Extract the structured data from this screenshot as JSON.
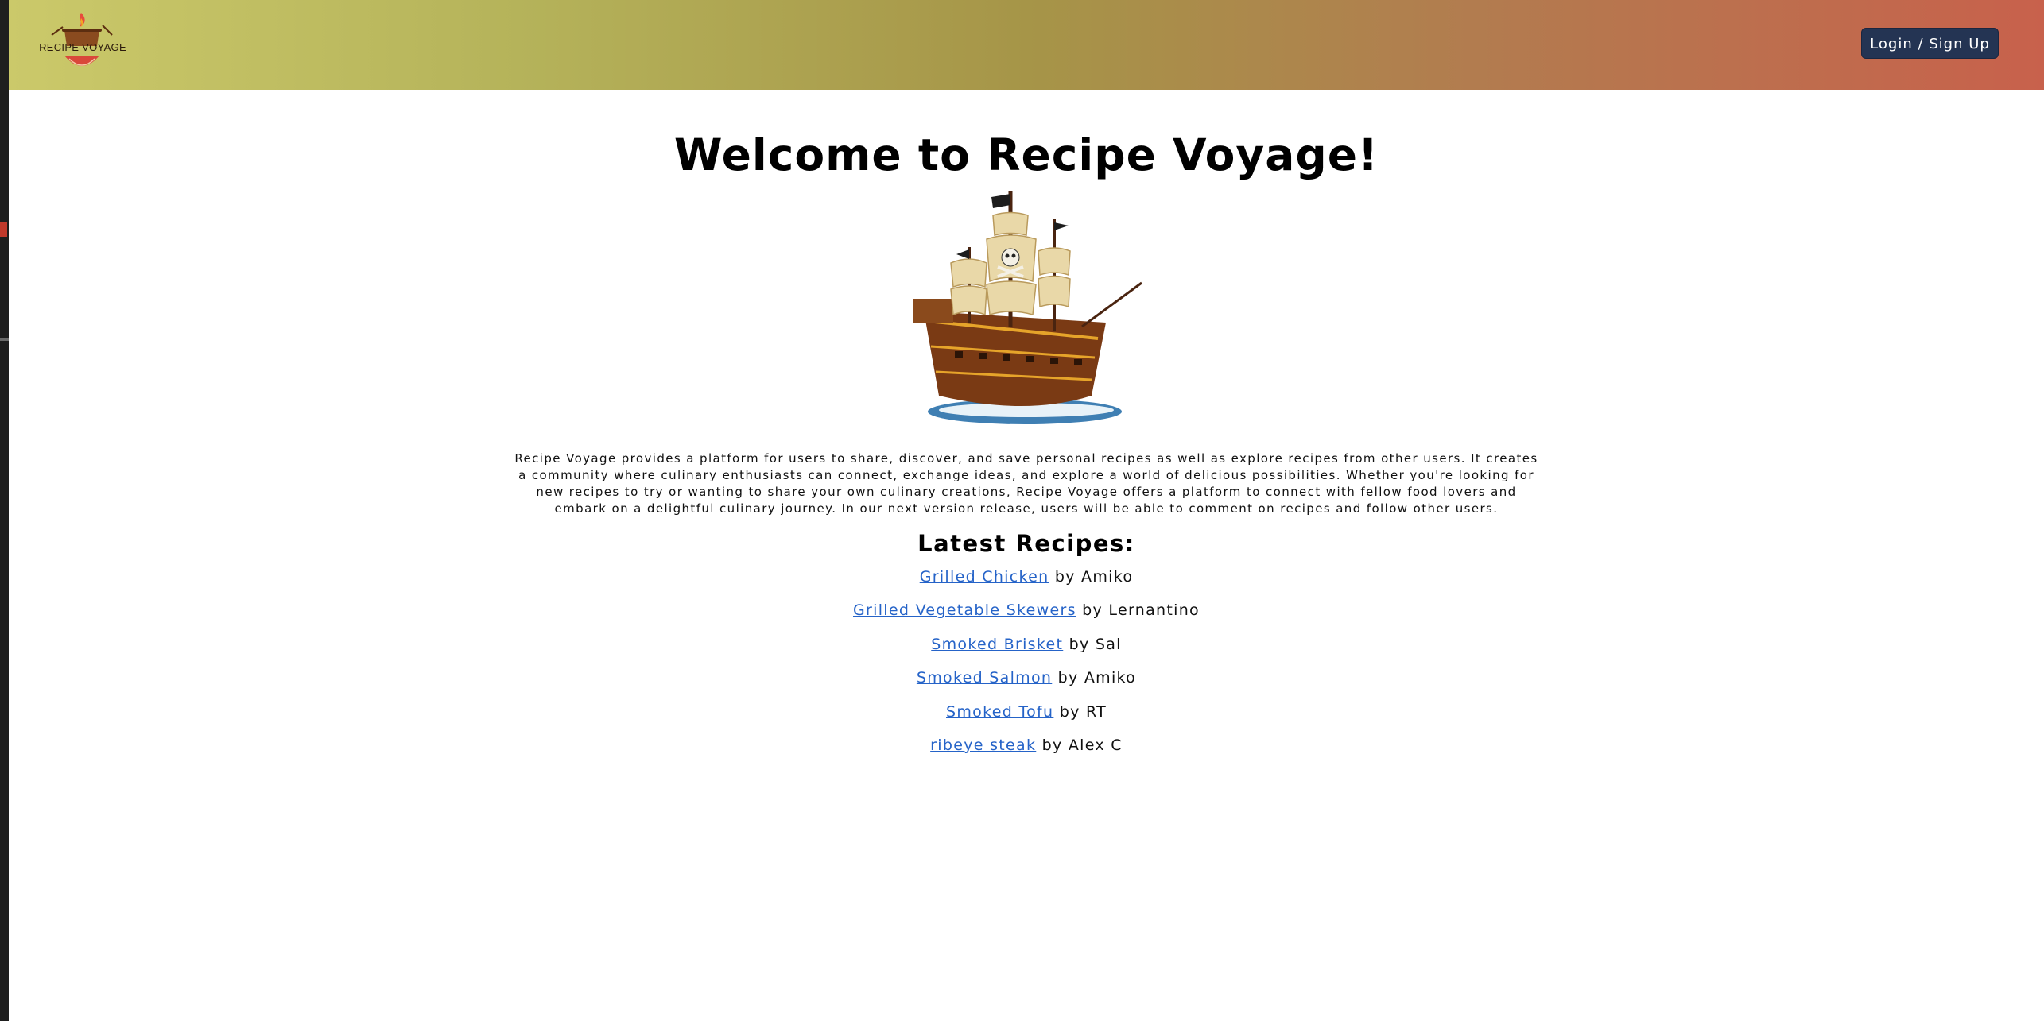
{
  "header": {
    "logo_text": "RECIPE VOYAGE",
    "login_label": "Login / Sign Up"
  },
  "main": {
    "title": "Welcome to Recipe Voyage!",
    "description": "Recipe Voyage provides a platform for users to share, discover, and save personal recipes as well as explore recipes from other users. It creates a community where culinary enthusiasts can connect, exchange ideas, and explore a world of delicious possibilities. Whether you're looking for new recipes to try or wanting to share your own culinary creations, Recipe Voyage offers a platform to connect with fellow food lovers and embark on a delightful culinary journey. In our next version release, users will be able to comment on recipes and follow other users.",
    "latest_heading": "Latest Recipes:",
    "recipes": [
      {
        "name": "Grilled Chicken",
        "author": "by Amiko"
      },
      {
        "name": "Grilled Vegetable Skewers",
        "author": "by Lernantino"
      },
      {
        "name": "Smoked Brisket",
        "author": "by Sal"
      },
      {
        "name": "Smoked Salmon",
        "author": "by Amiko"
      },
      {
        "name": "Smoked Tofu",
        "author": "by RT"
      },
      {
        "name": "ribeye steak",
        "author": "by Alex C"
      }
    ]
  },
  "colors": {
    "navbar_gradient_start": "#cbc96a",
    "navbar_gradient_end": "#c8614c",
    "button_bg": "#243453",
    "link": "#2563c8"
  },
  "icons": {
    "logo": "recipe-voyage-logo",
    "hero": "pirate-ship-image"
  }
}
